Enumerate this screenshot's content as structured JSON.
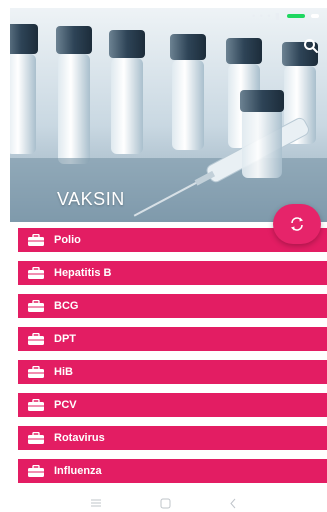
{
  "app": {
    "title": "VAKSIN"
  },
  "colors": {
    "accent": "#e31d63",
    "fab": "#e6246a",
    "text_on_accent": "#ffffff"
  },
  "icons": {
    "search": "search-icon",
    "fab": "refresh-icon",
    "item": "briefcase-icon",
    "nav": [
      "menu-icon",
      "home-square-icon",
      "back-chevron-icon"
    ]
  },
  "vaccines": [
    {
      "label": "Polio"
    },
    {
      "label": "Hepatitis B"
    },
    {
      "label": "BCG"
    },
    {
      "label": "DPT"
    },
    {
      "label": "HiB"
    },
    {
      "label": "PCV"
    },
    {
      "label": "Rotavirus"
    },
    {
      "label": "Influenza"
    }
  ]
}
